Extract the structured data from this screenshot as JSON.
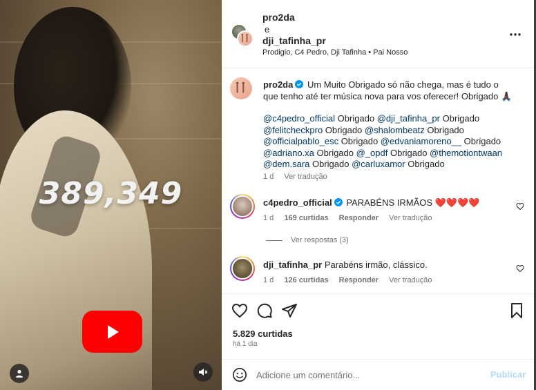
{
  "media": {
    "counter": "389,349",
    "play_icon": "youtube-play-icon",
    "profile_icon": "user-icon",
    "mute_icon": "speaker-muted-icon"
  },
  "header": {
    "user1": "pro2da",
    "conjunction": "e",
    "user2": "dji_tafinha_pr",
    "song": "Prodigio, C4 Pedro, Dji Tafinha • Pai Nosso"
  },
  "caption": {
    "user": "pro2da",
    "text": "Um Muito Obrigado só não chega, mas é tudo o que tenho até ter música nova para vos oferecer! Obrigado 🙏🏿",
    "mentions": [
      {
        "handle": "@c4pedro_official",
        "after": " Obrigado "
      },
      {
        "handle": "@dji_tafinha_pr",
        "after": " Obrigado "
      },
      {
        "handle": "@felitcheckpro",
        "after": " Obrigado "
      },
      {
        "handle": "@shalombeatz",
        "after": " Obrigado "
      },
      {
        "handle": "@officialpablo_esc",
        "after": " Obrigado "
      },
      {
        "handle": "@edvaniamoreno__",
        "after": " Obrigado "
      },
      {
        "handle": "@adriano.xa",
        "after": " Obrigado "
      },
      {
        "handle": "@_opdf",
        "after": " Obrigado "
      },
      {
        "handle": "@themotiontwaan",
        "after": " "
      },
      {
        "handle": "@dem.sara",
        "after": " Obrigado "
      },
      {
        "handle": "@carluxamor",
        "after": " Obrigado"
      }
    ],
    "time": "1 d",
    "see_translation": "Ver tradução"
  },
  "comments": [
    {
      "user": "c4pedro_official",
      "verified": true,
      "text": "PARABÉNS IRMÃOS ❤️❤️❤️❤️",
      "time": "1 d",
      "likes": "169 curtidas",
      "reply": "Responder",
      "see_translation": "Ver tradução"
    },
    {
      "user": "dji_tafinha_pr",
      "verified": false,
      "text": "Parabéns irmão, clássico.",
      "time": "1 d",
      "likes": "126 curtidas",
      "reply": "Responder",
      "see_translation": "Ver tradução"
    }
  ],
  "view_replies": "Ver respostas (3)",
  "actions": {
    "likes": "5.829 curtidas",
    "date": "há 1 dia"
  },
  "composer": {
    "placeholder": "Adicione um comentário...",
    "publish": "Publicar"
  },
  "colors": {
    "verified": "#0095f6",
    "mention": "#00376b",
    "publish_disabled": "#b3dbff",
    "youtube": "#ff0000"
  }
}
